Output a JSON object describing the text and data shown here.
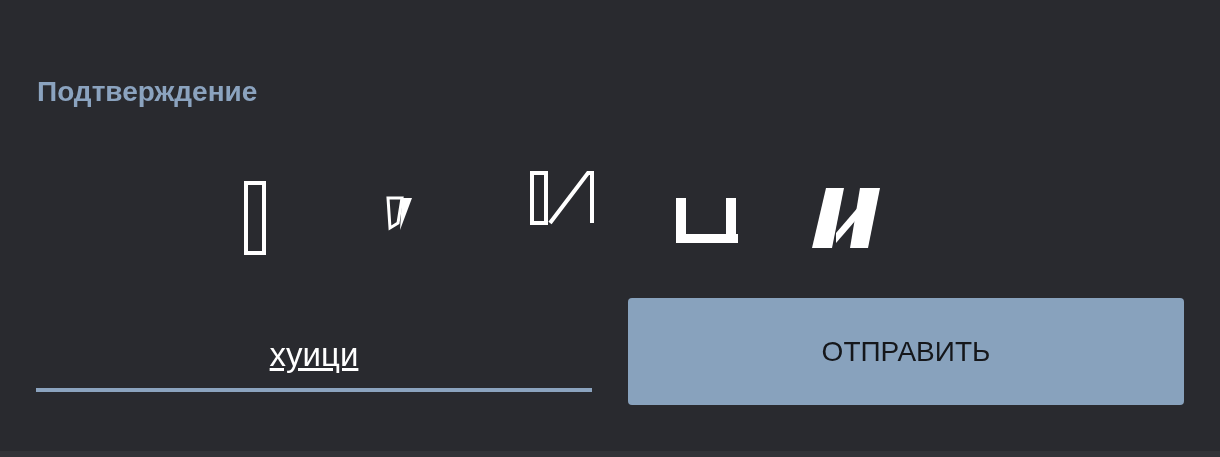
{
  "section_label": "Подтверждение",
  "answer_field": {
    "value": "хуици"
  },
  "submit_button": {
    "label": "ОТПРАВИТЬ"
  }
}
